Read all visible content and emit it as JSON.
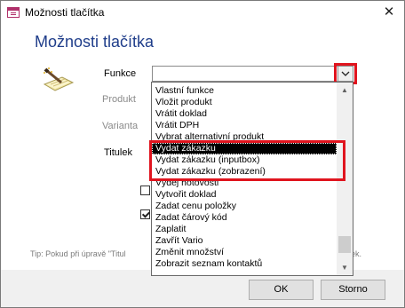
{
  "window": {
    "title": "Možnosti tlačítka",
    "close_glyph": "✕"
  },
  "heading": "Možnosti tlačítka",
  "labels": {
    "funkce": "Funkce",
    "produkt": "Produkt",
    "varianta": "Varianta",
    "titulek": "Titulek"
  },
  "funkce_value": "",
  "dropdown": {
    "items": [
      "Vlastní funkce",
      "Vložit produkt",
      "Vrátit doklad",
      "Vrátit DPH",
      "Vybrat alternativní produkt",
      "Vydat zákazku",
      "Vydat zákazku (inputbox)",
      "Vydat zákazku (zobrazení)",
      "Výdej hotovosti",
      "Vytvořit doklad",
      "Zadat cenu položky",
      "Zadat čárový kód",
      "Zaplatit",
      "Zavřít Vario",
      "Změnit množství",
      "Zobrazit seznam kontaktů"
    ],
    "selected_index": 5,
    "highlighted_items": [
      "Vydat zákazku",
      "Vydat zákazku (inputbox)",
      "Vydat zákazku (zobrazení)"
    ],
    "highlight_color": "#e0141e"
  },
  "checkboxes": [
    {
      "checked": false
    },
    {
      "checked": true
    }
  ],
  "tip": {
    "text": "Tip: Pokud při úpravě \"Titul",
    "tail": "ek."
  },
  "buttons": {
    "ok": "OK",
    "cancel": "Storno"
  },
  "icons": {
    "title": "form-icon",
    "wand": "magic-wand-icon",
    "close": "close-icon"
  }
}
